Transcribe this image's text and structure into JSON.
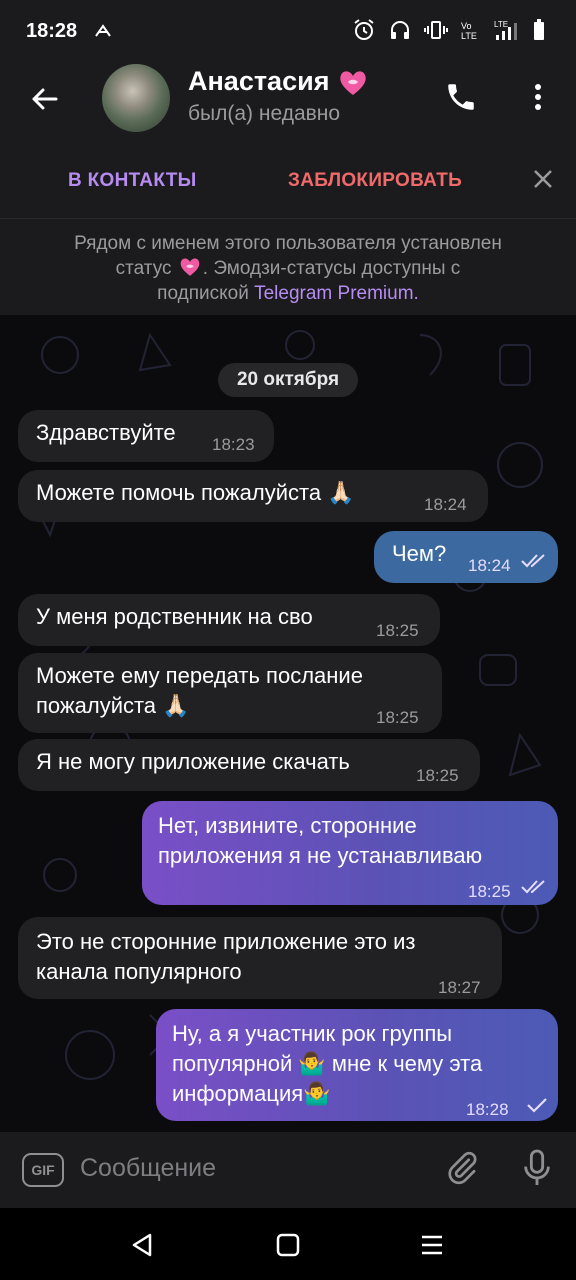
{
  "status_bar": {
    "time": "18:28"
  },
  "header": {
    "contact_name": "Анастасия",
    "contact_status": "был(а) недавно"
  },
  "actions": {
    "add_contact": "В КОНТАКТЫ",
    "block": "ЗАБЛОКИРОВАТЬ"
  },
  "info_banner": {
    "line1": "Рядом с именем этого пользователя установлен",
    "line2_prefix": "статус",
    "line2_suffix": ". Эмодзи-статусы доступны с",
    "line3_prefix": "подпиской",
    "premium_link": "Telegram Premium",
    "line3_suffix": "."
  },
  "date_separator": "20 октября",
  "messages": [
    {
      "direction": "in",
      "lines": [
        "Здравствуйте"
      ],
      "time": "18:23"
    },
    {
      "direction": "in",
      "lines": [
        "Можете помочь пожалуйста 🙏🏻"
      ],
      "time": "18:24"
    },
    {
      "direction": "out",
      "lines": [
        "Чем?"
      ],
      "time": "18:24",
      "read": true
    },
    {
      "direction": "in",
      "lines": [
        "У меня родственник на сво"
      ],
      "time": "18:25"
    },
    {
      "direction": "in",
      "lines": [
        "Можете ему передать послание",
        "пожалуйста 🙏🏻"
      ],
      "time": "18:25"
    },
    {
      "direction": "in",
      "lines": [
        "Я не могу приложение скачать"
      ],
      "time": "18:25"
    },
    {
      "direction": "out",
      "lines": [
        "Нет, извините, сторонние",
        "приложения я не устанавливаю"
      ],
      "time": "18:25",
      "read": true
    },
    {
      "direction": "in",
      "lines": [
        "Это не сторонние приложение это из",
        "канала популярного"
      ],
      "time": "18:27"
    },
    {
      "direction": "out",
      "lines": [
        "Ну, а я участник рок группы",
        "популярной 🤷‍♂️ мне к чему эта",
        "информация🤷‍♂️"
      ],
      "time": "18:28",
      "read": false
    }
  ],
  "composer": {
    "gif_label": "GIF",
    "placeholder": "Сообщение"
  },
  "colors": {
    "accent": "#b78cf0",
    "danger": "#ef6a6a",
    "outgoing_start": "#7a4fc7",
    "outgoing_end": "#4c5bb5",
    "incoming": "#212124"
  },
  "icons": [
    "back-arrow-icon",
    "heart-emoji-icon",
    "phone-icon",
    "more-vert-icon",
    "close-icon",
    "double-check-icon",
    "single-check-icon",
    "gif-icon",
    "attach-icon",
    "mic-icon",
    "nav-back-icon",
    "nav-home-icon",
    "nav-recents-icon"
  ]
}
